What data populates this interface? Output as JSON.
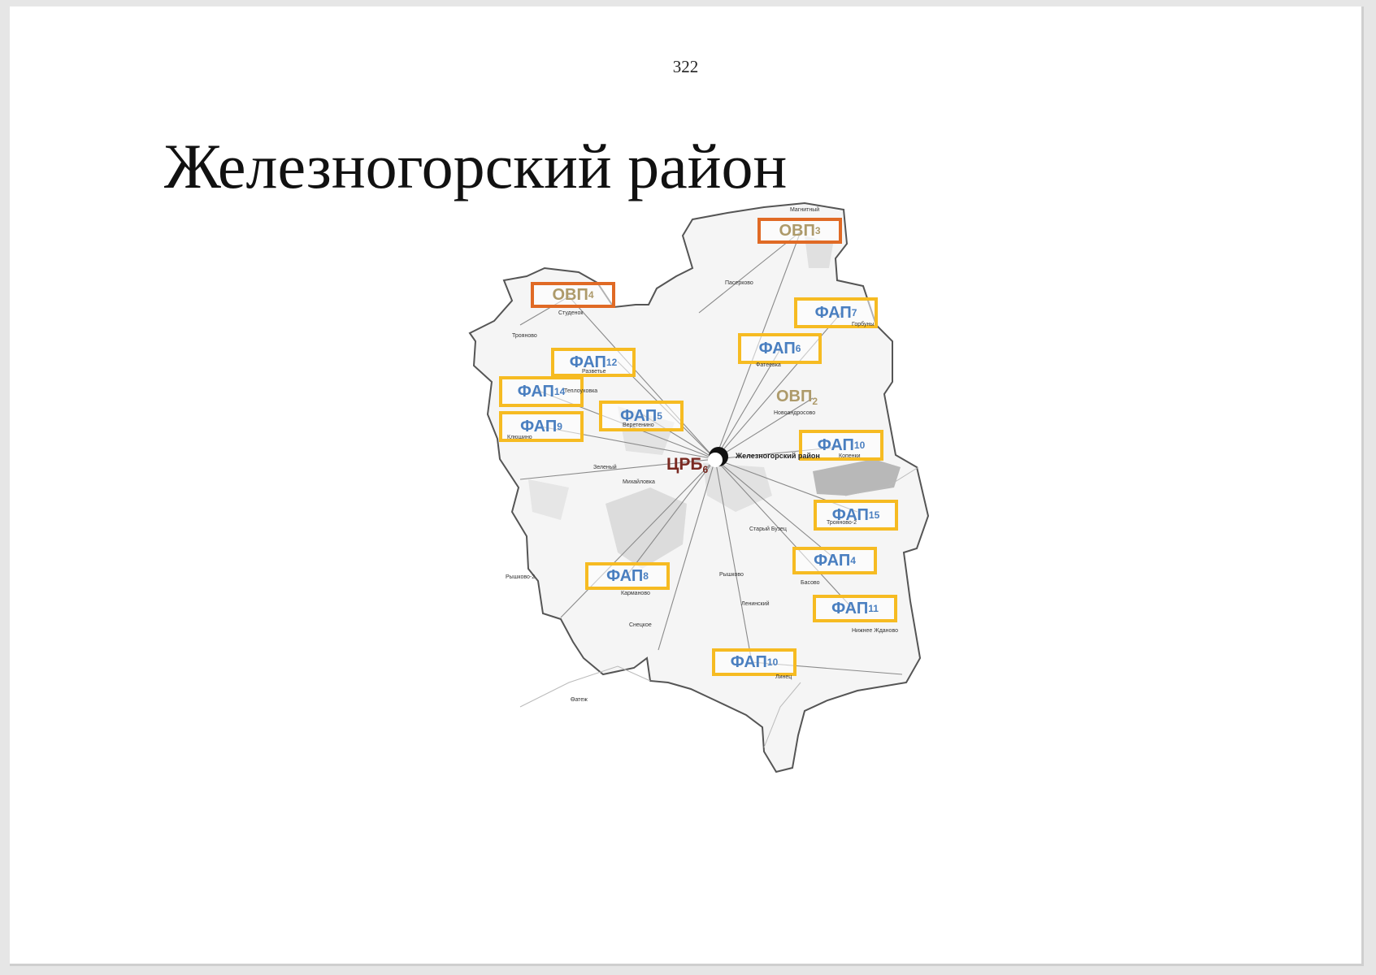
{
  "page_number": "322",
  "title": "Железногорский район",
  "map": {
    "district_label": "Железногорский район",
    "center": {
      "abbr": "ЦРБ",
      "num": "6"
    },
    "facilities": [
      {
        "id": "ovp3",
        "abbr": "ОВП",
        "num": "3",
        "kind": "ОВП"
      },
      {
        "id": "ovp4",
        "abbr": "ОВП",
        "num": "4",
        "kind": "ОВП"
      },
      {
        "id": "ovp2",
        "abbr": "ОВП",
        "num": "2",
        "kind": "ОВП"
      },
      {
        "id": "fap7",
        "abbr": "ФАП",
        "num": "7",
        "kind": "ФАП"
      },
      {
        "id": "fap6",
        "abbr": "ФАП",
        "num": "6",
        "kind": "ФАП"
      },
      {
        "id": "fap-top",
        "abbr": "ФАП",
        "num": "12",
        "kind": "ФАП"
      },
      {
        "id": "fap14",
        "abbr": "ФАП",
        "num": "14",
        "kind": "ФАП"
      },
      {
        "id": "fap9",
        "abbr": "ФАП",
        "num": "9",
        "kind": "ФАП"
      },
      {
        "id": "fap5",
        "abbr": "ФАП",
        "num": "5",
        "kind": "ФАП"
      },
      {
        "id": "fap10a",
        "abbr": "ФАП",
        "num": "10",
        "kind": "ФАП"
      },
      {
        "id": "fap15",
        "abbr": "ФАП",
        "num": "15",
        "kind": "ФАП"
      },
      {
        "id": "fap4",
        "abbr": "ФАП",
        "num": "4",
        "kind": "ФАП"
      },
      {
        "id": "fap8",
        "abbr": "ФАП",
        "num": "8",
        "kind": "ФАП"
      },
      {
        "id": "fap11",
        "abbr": "ФАП",
        "num": "11",
        "kind": "ФАП"
      },
      {
        "id": "fap10b",
        "abbr": "ФАП",
        "num": "10",
        "kind": "ФАП"
      }
    ],
    "places": [
      "Магнитный",
      "Пасерково",
      "Студенок",
      "Трояново",
      "Горбуны",
      "Фатеевка",
      "Разветье",
      "Теплоуховка",
      "Новоандросово",
      "Клюшино",
      "Веретенино",
      "Зеленый",
      "Михайловка",
      "Копенки",
      "Трояново-2",
      "Старый Бузец",
      "Басово",
      "Рышково",
      "Карманово",
      "Ленинский",
      "Снецкое",
      "Нижнее Жданово",
      "Линец",
      "Рышково-2",
      "Ѳатеж"
    ],
    "colors": {
      "fap_border": "#f6bb22",
      "ovp_border": "#e06a25",
      "fap_text": "#4a7fc0",
      "ovp_text": "#ad9a6a",
      "crb_text": "#7a2a22"
    }
  }
}
